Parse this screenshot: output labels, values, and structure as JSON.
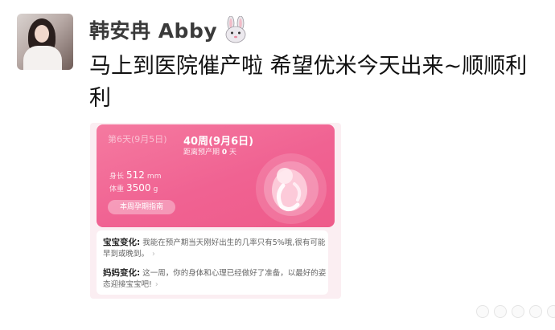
{
  "post": {
    "author": "韩安冉 Abby",
    "text": "马上到医院催产啦 希望优米今天出来~顺顺利利"
  },
  "card": {
    "prev_day": "第6天(9月5日)",
    "week_label": "40周(9月6日)",
    "due_prefix": "距离预产期",
    "due_days": "0",
    "due_suffix": "天",
    "length_label": "身长",
    "length_value": "512",
    "length_unit": "mm",
    "weight_label": "体重",
    "weight_value": "3500",
    "weight_unit": "g",
    "guide_button": "本周孕期指南",
    "baby_change_label": "宝宝变化:",
    "baby_change_text": "我能在预产期当天刚好出生的几率只有5%哦,很有可能早到或晚到。",
    "mom_change_label": "妈妈变化:",
    "mom_change_text": "这一周，你的身体和心理已经做好了准备，以最好的姿态迎接宝宝吧!"
  },
  "icons": [
    "avatar-photo",
    "bunny-emoji-icon",
    "fetus-illustration",
    "chevron-right-icon"
  ],
  "colors": {
    "card_pink": "#f06292",
    "card_bg": "#fbeef2"
  }
}
